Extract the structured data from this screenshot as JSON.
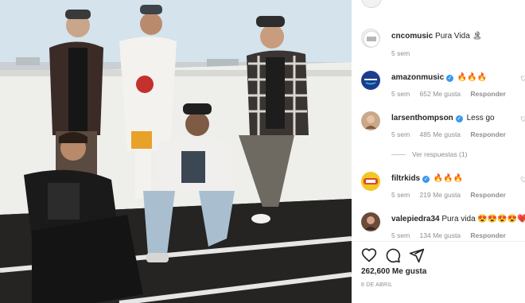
{
  "post": {
    "image_alt": "Group photo of five young men on a rooftop",
    "caption": {
      "user": "cncomusic",
      "text": "Pura Vida 🏝",
      "time": "5 sem"
    },
    "comments": [
      {
        "user": "amazonmusic",
        "verified": true,
        "text": "🔥🔥🔥",
        "time": "5 sem",
        "likes": "652 Me gusta",
        "reply": "Responder",
        "avatar_color": "#1c3d8f"
      },
      {
        "user": "larsenthompson",
        "verified": true,
        "text": "Less go",
        "time": "5 sem",
        "likes": "485 Me gusta",
        "reply": "Responder",
        "avatar_color": "#c9a88a",
        "view_replies": "Ver respuestas (1)"
      },
      {
        "user": "filtrkids",
        "verified": true,
        "text": "🔥🔥🔥",
        "time": "5 sem",
        "likes": "219 Me gusta",
        "reply": "Responder",
        "avatar_color": "#f3c623"
      },
      {
        "user": "valepiedra34",
        "verified": false,
        "text": "Pura vida 😍😍😍😍❤️",
        "time": "5 sem",
        "likes": "134 Me gusta",
        "reply": "Responder",
        "avatar_color": "#6b4a3a"
      }
    ],
    "likes_count": "262,600 Me gusta",
    "date": "8 DE ABRIL"
  },
  "icons": [
    "heart-icon",
    "comment-icon",
    "share-icon",
    "verified-badge-icon"
  ],
  "colors": {
    "verified": "#3897f0",
    "muted": "#8e8e8e",
    "text": "#262626"
  }
}
